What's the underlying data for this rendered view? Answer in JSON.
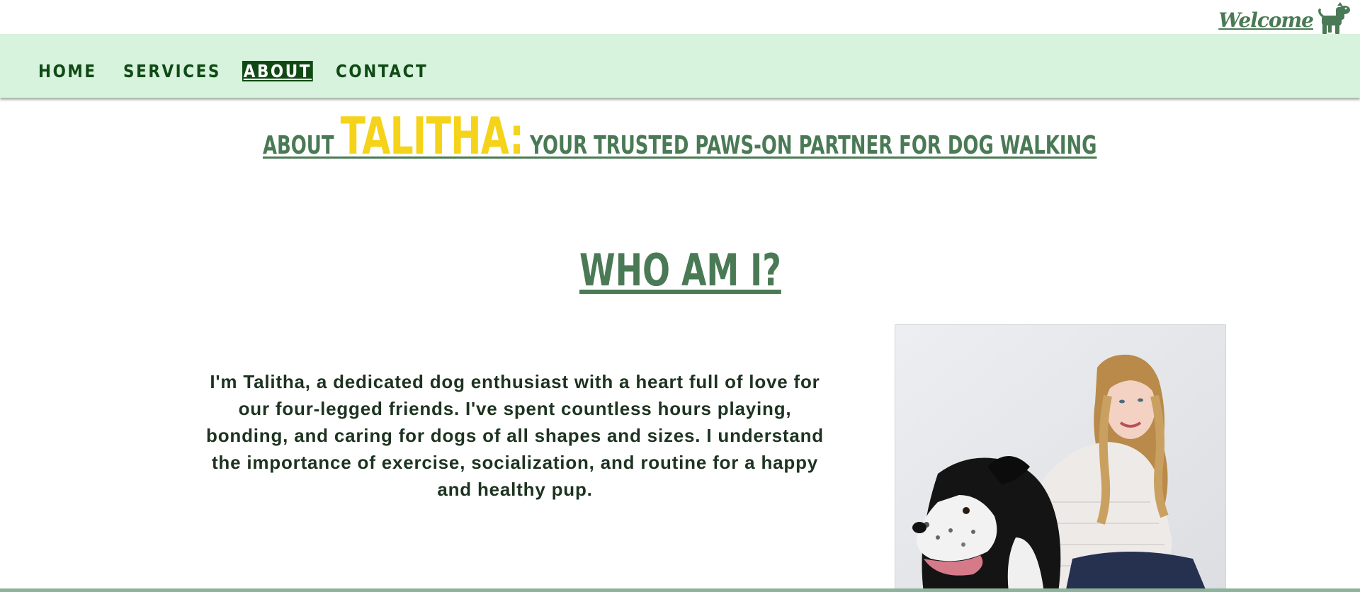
{
  "header": {
    "welcome_label": "Welcome",
    "logo_icon": "dog-icon"
  },
  "nav": {
    "items": [
      {
        "label": "HOME"
      },
      {
        "label": "SERVICES"
      },
      {
        "label": "ABOUT",
        "active": true
      },
      {
        "label": "CONTACT"
      }
    ]
  },
  "headline": {
    "prefix": "ABOUT ",
    "name": "TALITHA:",
    "suffix": " YOUR TRUSTED PAWS-ON PARTNER FOR DOG WALKING"
  },
  "section": {
    "title": "WHO AM I?",
    "bio": "I'm Talitha, a dedicated dog enthusiast with a heart full of love for our four-legged friends. I've spent countless hours playing, bonding, and caring for dogs of all shapes and sizes. I understand the importance of exercise, socialization, and routine for a happy and healthy pup."
  },
  "colors": {
    "nav_background": "#d7f2dd",
    "nav_text": "#0f4a14",
    "heading_green": "#4a7a55",
    "accent_yellow": "#f5d31a",
    "body_text": "#1d3320"
  }
}
